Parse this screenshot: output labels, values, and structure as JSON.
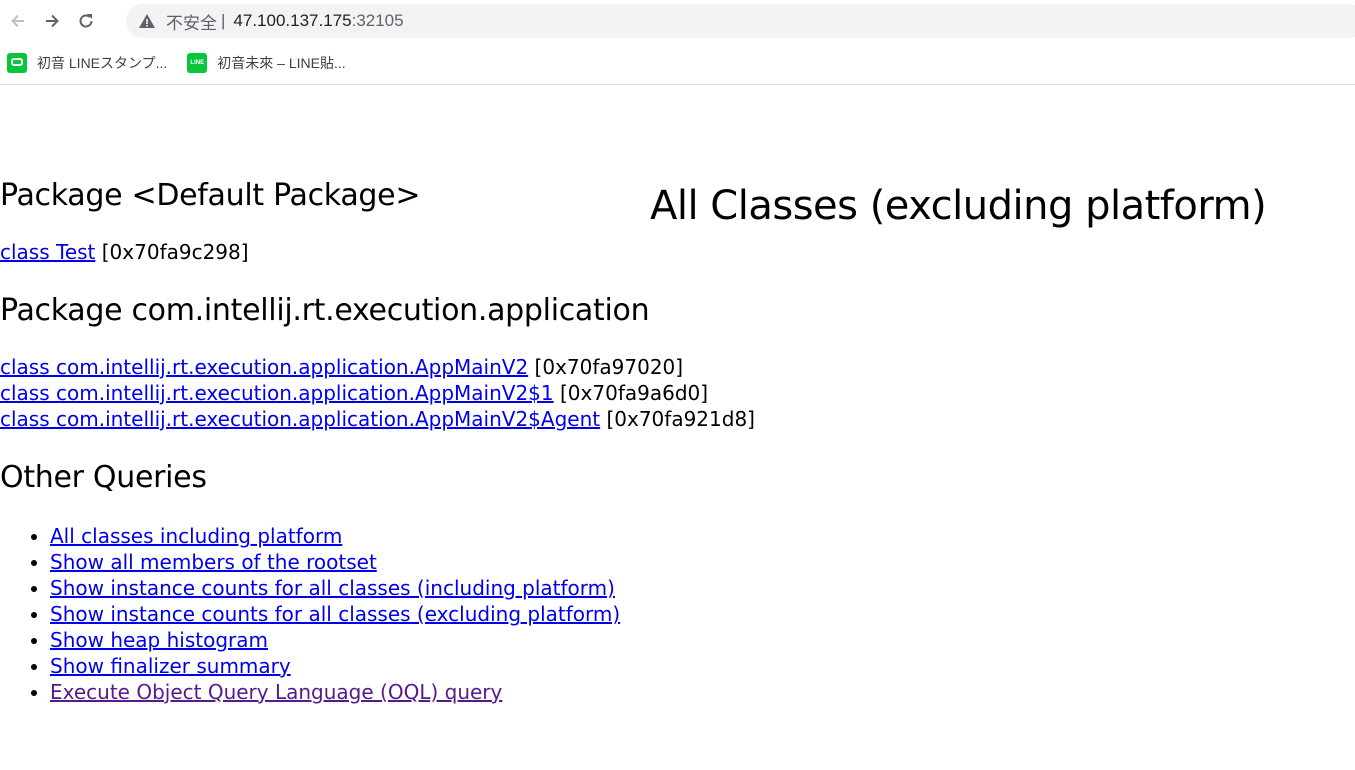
{
  "browser": {
    "not_secure": "不安全",
    "separator": "|",
    "url_host": "47.100.137.175",
    "url_port": ":32105",
    "bookmarks": [
      {
        "label": "初音 LINEスタンプ..."
      },
      {
        "label": "初音未來 – LINE貼..."
      }
    ],
    "bookmark_icon_text": "LINE STORE"
  },
  "page": {
    "title": "All Classes (excluding platform)",
    "packages": [
      {
        "heading": "Package <Default Package>",
        "classes": [
          {
            "link": "class Test",
            "addr": "[0x70fa9c298]"
          }
        ]
      },
      {
        "heading": "Package com.intellij.rt.execution.application",
        "classes": [
          {
            "link": "class com.intellij.rt.execution.application.AppMainV2",
            "addr": "[0x70fa97020]"
          },
          {
            "link": "class com.intellij.rt.execution.application.AppMainV2$1",
            "addr": "[0x70fa9a6d0]"
          },
          {
            "link": "class com.intellij.rt.execution.application.AppMainV2$Agent",
            "addr": "[0x70fa921d8]"
          }
        ]
      }
    ],
    "other_heading": "Other Queries",
    "queries": [
      "All classes including platform",
      "Show all members of the rootset",
      "Show instance counts for all classes (including platform)",
      "Show instance counts for all classes (excluding platform)",
      "Show heap histogram",
      "Show finalizer summary",
      "Execute Object Query Language (OQL) query"
    ]
  }
}
